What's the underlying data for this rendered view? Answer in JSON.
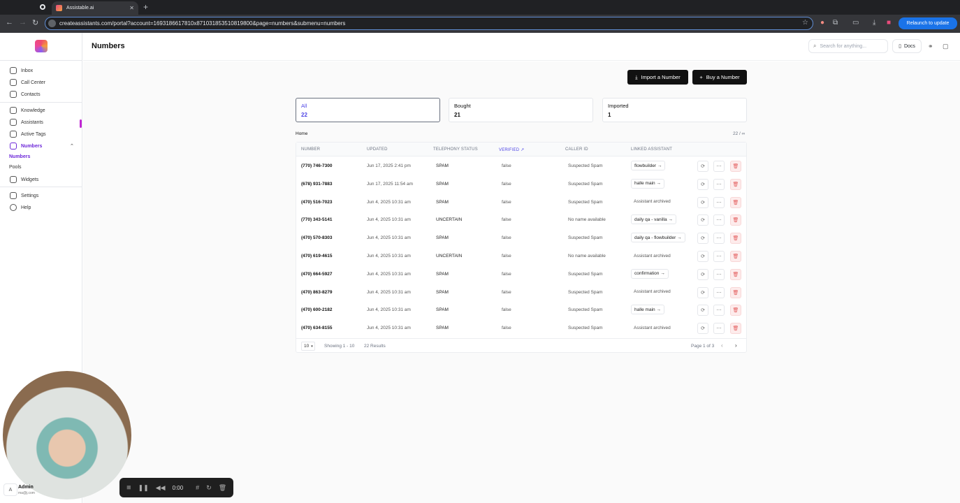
{
  "browser": {
    "tab_title": "Assistable.ai",
    "url": "createassistants.com/portal?account=1693186617810x871031853510819800&page=numbers&submenu=numbers",
    "relaunch_label": "Relaunch to update"
  },
  "sidebar": {
    "items": [
      {
        "label": "Inbox",
        "icon": "inbox-icon"
      },
      {
        "label": "Call Center",
        "icon": "phone-icon"
      },
      {
        "label": "Contacts",
        "icon": "contacts-icon"
      },
      {
        "label": "Knowledge",
        "icon": "database-icon"
      },
      {
        "label": "Assistants",
        "icon": "assistant-icon"
      },
      {
        "label": "Active Tags",
        "icon": "tag-icon"
      },
      {
        "label": "Numbers",
        "icon": "mobile-icon"
      },
      {
        "label": "Widgets",
        "icon": "widget-icon"
      },
      {
        "label": "Settings",
        "icon": "gear-icon"
      },
      {
        "label": "Help",
        "icon": "help-icon"
      }
    ],
    "submenu": [
      "Numbers",
      "Pools"
    ],
    "user": {
      "initial": "A",
      "name": "Admin",
      "email": "ma@j.com"
    }
  },
  "header": {
    "title": "Numbers",
    "search_placeholder": "Search for anything...",
    "docs_label": "Docs"
  },
  "actions": {
    "import_label": "Import a Number",
    "buy_label": "Buy a Number"
  },
  "summary_cards": [
    {
      "label": "All",
      "value": "22"
    },
    {
      "label": "Bought",
      "value": "21"
    },
    {
      "label": "Imported",
      "value": "1"
    }
  ],
  "breadcrumb": "Home",
  "count_label": "22 / ∞",
  "table": {
    "columns": [
      "NUMBER",
      "UPDATED",
      "TELEPHONY STATUS",
      "VERIFIED",
      "CALLER ID",
      "LINKED ASSISTANT"
    ],
    "rows": [
      {
        "number": "(770) 746-7300",
        "updated": "Jun 17, 2025 2:41 pm",
        "status": "SPAM",
        "verified": "false",
        "caller_id": "Suspected Spam",
        "assistant": "flowbuilder →",
        "linked": true
      },
      {
        "number": "(678) 931-7883",
        "updated": "Jun 17, 2025 11:54 am",
        "status": "SPAM",
        "verified": "false",
        "caller_id": "Suspected Spam",
        "assistant": "halle main →",
        "linked": true
      },
      {
        "number": "(470) 516-7023",
        "updated": "Jun 4, 2025 10:31 am",
        "status": "SPAM",
        "verified": "false",
        "caller_id": "Suspected Spam",
        "assistant": "Assistant archived",
        "linked": false
      },
      {
        "number": "(770) 343-5141",
        "updated": "Jun 4, 2025 10:31 am",
        "status": "UNCERTAIN",
        "verified": "false",
        "caller_id": "No name available",
        "assistant": "daily qa - vanilla →",
        "linked": true
      },
      {
        "number": "(470) 570-8303",
        "updated": "Jun 4, 2025 10:31 am",
        "status": "SPAM",
        "verified": "false",
        "caller_id": "Suspected Spam",
        "assistant": "daily qa - flowbuilder →",
        "linked": true
      },
      {
        "number": "(470) 619-4615",
        "updated": "Jun 4, 2025 10:31 am",
        "status": "UNCERTAIN",
        "verified": "false",
        "caller_id": "No name available",
        "assistant": "Assistant archived",
        "linked": false
      },
      {
        "number": "(470) 664-5927",
        "updated": "Jun 4, 2025 10:31 am",
        "status": "SPAM",
        "verified": "false",
        "caller_id": "Suspected Spam",
        "assistant": "confirmation →",
        "linked": true
      },
      {
        "number": "(470) 863-8279",
        "updated": "Jun 4, 2025 10:31 am",
        "status": "SPAM",
        "verified": "false",
        "caller_id": "Suspected Spam",
        "assistant": "Assistant archived",
        "linked": false
      },
      {
        "number": "(470) 600-2182",
        "updated": "Jun 4, 2025 10:31 am",
        "status": "SPAM",
        "verified": "false",
        "caller_id": "Suspected Spam",
        "assistant": "halle main →",
        "linked": true
      },
      {
        "number": "(470) 634-8155",
        "updated": "Jun 4, 2025 10:31 am",
        "status": "SPAM",
        "verified": "false",
        "caller_id": "Suspected Spam",
        "assistant": "Assistant archived",
        "linked": false
      }
    ]
  },
  "footer": {
    "per_page": "10",
    "showing": "Showing 1 - 10",
    "results": "22 Results",
    "page": "Page 1 of 3"
  },
  "recorder": {
    "time": "0:00"
  }
}
